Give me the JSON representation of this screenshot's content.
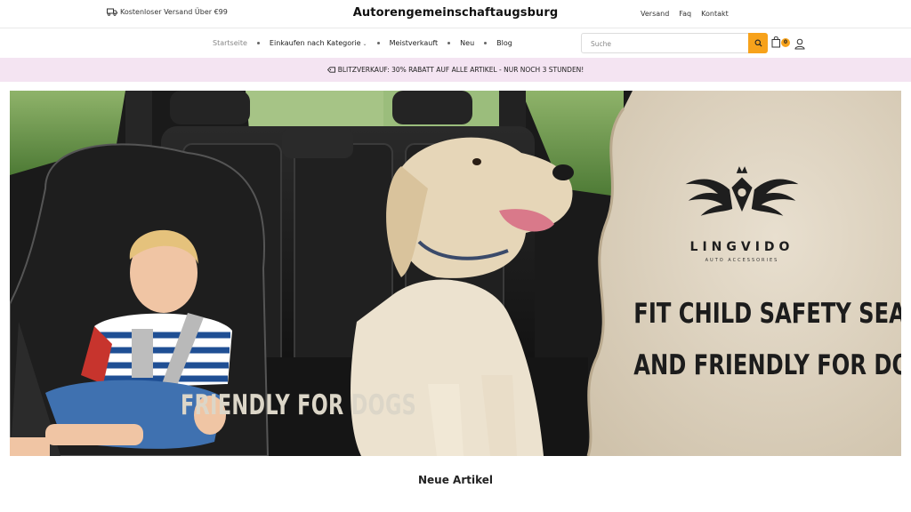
{
  "topbar": {
    "shipping_text": "Kostenloser Versand Über €99",
    "brand": "Autorengemeinschaftaugsburg",
    "links": [
      "Versand",
      "Faq",
      "Kontakt"
    ]
  },
  "nav": {
    "items": [
      {
        "label": "Startseite"
      },
      {
        "label": "Einkaufen nach Kategorie"
      },
      {
        "label": "Meistverkauft"
      },
      {
        "label": "Neu"
      },
      {
        "label": "Blog"
      }
    ],
    "search_placeholder": "Suche",
    "cart_count": "0"
  },
  "promo": {
    "text": "BLITZVERKAUF: 30% RABATT AUF ALLE ARTIKEL - NUR NOCH 3 STUNDEN!"
  },
  "banner": {
    "brand_name": "LINGVIDO",
    "brand_tagline": "AUTO ACCESSORIES",
    "headline_line1": "FIT CHILD SAFETY SEAT",
    "headline_line2": "AND FRIENDLY FOR DOGS",
    "left_caption": "FRIENDLY FOR DOGS"
  },
  "main": {
    "section_title": "Neue Artikel"
  },
  "colors": {
    "accent": "#f7a21b",
    "promo_bg": "#f4e4f2",
    "panel_bg": "#ddd2c0"
  }
}
